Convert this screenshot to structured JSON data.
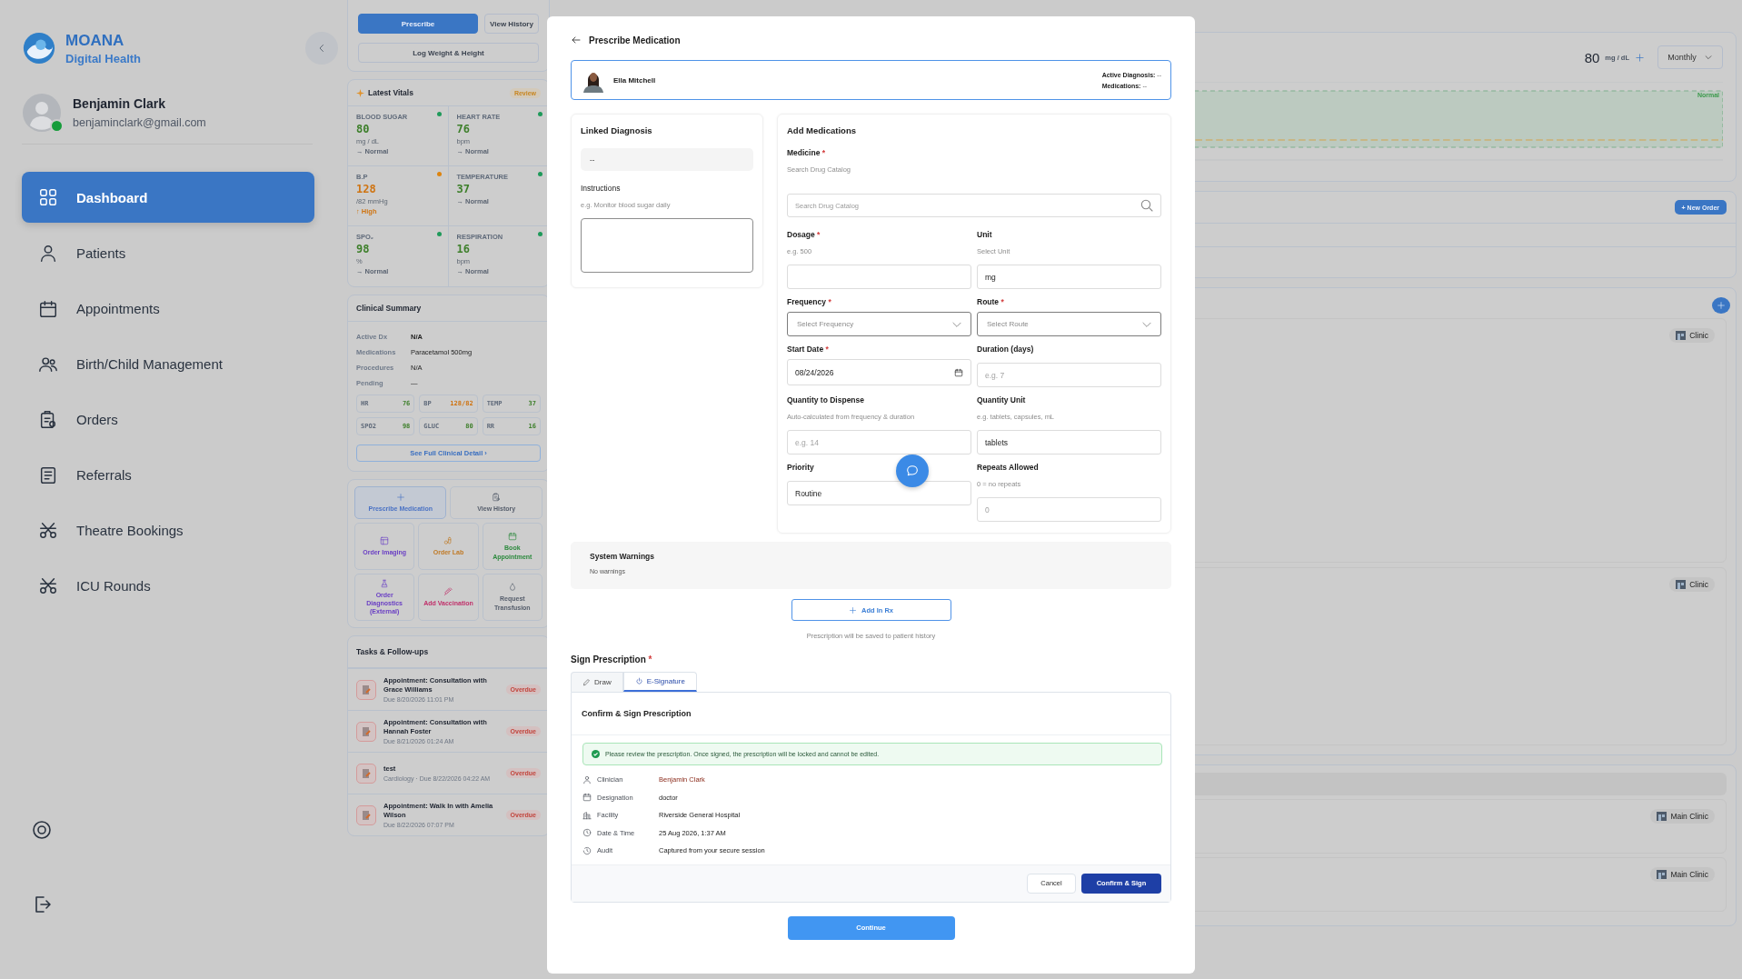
{
  "sidebar": {
    "brand": {
      "name": "MOANA",
      "tagline": "Digital Health"
    },
    "user": {
      "name": "Benjamin Clark",
      "email": "benjaminclark@gmail.com",
      "online": true
    },
    "nav": [
      {
        "label": "Dashboard",
        "selected": true
      },
      {
        "label": "Patients",
        "selected": false
      },
      {
        "label": "Appointments",
        "selected": false
      },
      {
        "label": "Birth/Child Management",
        "selected": false
      },
      {
        "label": "Orders",
        "selected": false
      },
      {
        "label": "Referrals",
        "selected": false
      },
      {
        "label": "Theatre Bookings",
        "selected": false
      },
      {
        "label": "ICU Rounds",
        "selected": false
      }
    ]
  },
  "patient_panel": {
    "quick_buttons": [
      {
        "label": "Prescribe",
        "kind": "primary"
      },
      {
        "label": "View History",
        "kind": "secondary"
      },
      {
        "label": "Log Weight & Height",
        "kind": "secondary"
      }
    ],
    "vitals": {
      "title": "Latest Vitals",
      "badge": "Review",
      "items": [
        {
          "label": "BLOOD SUGAR",
          "value": "80",
          "unit": "mg / dL",
          "note": "→ Normal",
          "kind": "normal"
        },
        {
          "label": "HEART RATE",
          "value": "76",
          "unit": "bpm",
          "note": "→ Normal",
          "kind": "normal"
        },
        {
          "label": "B.P",
          "value": "128",
          "unit": "/82 mmHg",
          "note": "↑ High",
          "kind": "high"
        },
        {
          "label": "TEMPERATURE",
          "value": "37",
          "note": "→ Normal",
          "kind": "normal"
        },
        {
          "label": "SPO₂",
          "value": "98",
          "unit": "%",
          "note": "→ Normal",
          "kind": "normal"
        },
        {
          "label": "RESPIRATION",
          "value": "16",
          "unit": "bpm",
          "note": "→ Normal",
          "kind": "normal"
        }
      ]
    },
    "summary": {
      "title": "Clinical Summary",
      "rows": [
        {
          "label": "Active Dx",
          "value": "N/A",
          "bold": true
        },
        {
          "label": "Medications",
          "value": "Paracetamol 500mg",
          "bold": false
        },
        {
          "label": "Procedures",
          "value": "N/A",
          "bold": false
        },
        {
          "label": "Pending",
          "value": "—",
          "bold": false
        }
      ],
      "chips": [
        {
          "label": "HR",
          "value": "76",
          "kind": "normal"
        },
        {
          "label": "BP",
          "value": "128/82",
          "kind": "high"
        },
        {
          "label": "TEMP",
          "value": "37",
          "kind": "normal"
        },
        {
          "label": "SPO2",
          "value": "98",
          "kind": "normal"
        },
        {
          "label": "GLUC",
          "value": "80",
          "kind": "normal"
        },
        {
          "label": "RR",
          "value": "16",
          "kind": "normal"
        }
      ],
      "link": "See Full Clinical Detail ›"
    },
    "actions": [
      {
        "label": "Prescribe Medication",
        "color": "#4a72c4",
        "selected": true
      },
      {
        "label": "View History",
        "color": "#555d6b",
        "selected": false
      },
      {
        "label": "Order Imaging",
        "color": "#6a3fc4",
        "selected": false
      },
      {
        "label": "Order Lab",
        "color": "#c07a26",
        "selected": false
      },
      {
        "label": "Book Appointment",
        "color": "#2d8a3e",
        "selected": false
      },
      {
        "label": "Order Diagnostics (External)",
        "color": "#6a3fc4",
        "selected": false
      },
      {
        "label": "Add Vaccination",
        "color": "#c0306a",
        "selected": false
      },
      {
        "label": "Request Transfusion",
        "color": "#555d6b",
        "selected": false
      }
    ],
    "tasks": {
      "title": "Tasks & Follow-ups",
      "items": [
        {
          "title": "Appointment: Consultation with Grace Williams",
          "due": "Due 8/20/2026 11:01 PM",
          "badge": "Overdue"
        },
        {
          "title": "Appointment: Consultation with Hannah Foster",
          "due": "Due 8/21/2026 01:24 AM",
          "badge": "Overdue"
        },
        {
          "title": "test",
          "due": "Cardiology · Due 8/22/2026 04:22 AM",
          "badge": "Overdue"
        },
        {
          "title": "Appointment: Walk In with Amelia Wilson",
          "due": "Due 8/22/2026 07:07 PM",
          "badge": "Overdue"
        }
      ]
    }
  },
  "background": {
    "glucose": {
      "value": "80",
      "unit": "mg / dL",
      "period": "Monthly",
      "band_label": "Normal"
    },
    "orders": {
      "button": "+ New Order"
    },
    "encounters": [
      {
        "location": "Clinic"
      },
      {
        "location": "Clinic"
      }
    ],
    "schedule": [
      {
        "location": "Main Clinic"
      },
      {
        "location": "Main Clinic"
      }
    ]
  },
  "modal": {
    "title": "Prescribe Medication",
    "patient": {
      "name": "Ella Mitchell",
      "diagnosis_label": "Active Diagnosis:",
      "diagnosis": "--",
      "medications_label": "Medications:",
      "medications": "--"
    },
    "diagnosis": {
      "title": "Linked Diagnosis",
      "value": "--",
      "instructions_label": "Instructions",
      "instructions_hint": "e.g. Monitor blood sugar daily"
    },
    "medications": {
      "title": "Add Medications",
      "medicine": {
        "label": "Medicine",
        "required_mark": "*",
        "hint": "Search Drug Catalog",
        "placeholder": "Search Drug Catalog"
      },
      "fields": [
        {
          "label": "Dosage",
          "required_mark": "*",
          "hint": "e.g. 500",
          "kind": "input"
        },
        {
          "label": "Unit",
          "hint": "Select Unit",
          "kind": "input",
          "value": "mg"
        },
        {
          "label": "Frequency",
          "required_mark": "*",
          "kind": "select",
          "placeholder": "Select Frequency"
        },
        {
          "label": "Route",
          "required_mark": "*",
          "kind": "select",
          "placeholder": "Select Route"
        },
        {
          "label": "Start Date",
          "required_mark": "*",
          "kind": "date",
          "value": "08/24/2026"
        },
        {
          "label": "Duration (days)",
          "kind": "input",
          "placeholder": "e.g. 7"
        },
        {
          "label": "Quantity to Dispense",
          "hint": "Auto-calculated from frequency & duration",
          "kind": "input",
          "placeholder": "e.g. 14"
        },
        {
          "label": "Quantity Unit",
          "hint": "e.g. tablets, capsules, mL",
          "kind": "input",
          "value": "tablets"
        },
        {
          "label": "Priority",
          "kind": "input",
          "value": "Routine"
        },
        {
          "label": "Repeats Allowed",
          "hint": "0 = no repeats",
          "kind": "input",
          "placeholder": "0"
        }
      ]
    },
    "warnings": {
      "title": "System Warnings",
      "text": "No warnings"
    },
    "add_button": "Add In Rx",
    "note": "Prescription will be saved to patient history",
    "sign": {
      "title": "Sign Prescription",
      "required_mark": "*",
      "tabs": [
        {
          "label": "Draw",
          "selected": false
        },
        {
          "label": "E-Signature",
          "selected": true
        }
      ],
      "confirm": {
        "title": "Confirm & Sign Prescription",
        "alert": "Please review the prescription. Once signed, the prescription will be locked and cannot be edited.",
        "rows": [
          {
            "label": "Clinician",
            "value": "Benjamin Clark",
            "emphasis": true
          },
          {
            "label": "Designation",
            "value": "doctor",
            "emphasis": false
          },
          {
            "label": "Facility",
            "value": "Riverside General Hospital",
            "emphasis": false
          },
          {
            "label": "Date & Time",
            "value": "25 Aug 2026, 1:37 AM",
            "emphasis": false
          },
          {
            "label": "Audit",
            "value": "Captured from your secure session",
            "emphasis": false
          }
        ],
        "cancel": "Cancel",
        "submit": "Confirm & Sign"
      }
    },
    "continue": "Continue"
  }
}
